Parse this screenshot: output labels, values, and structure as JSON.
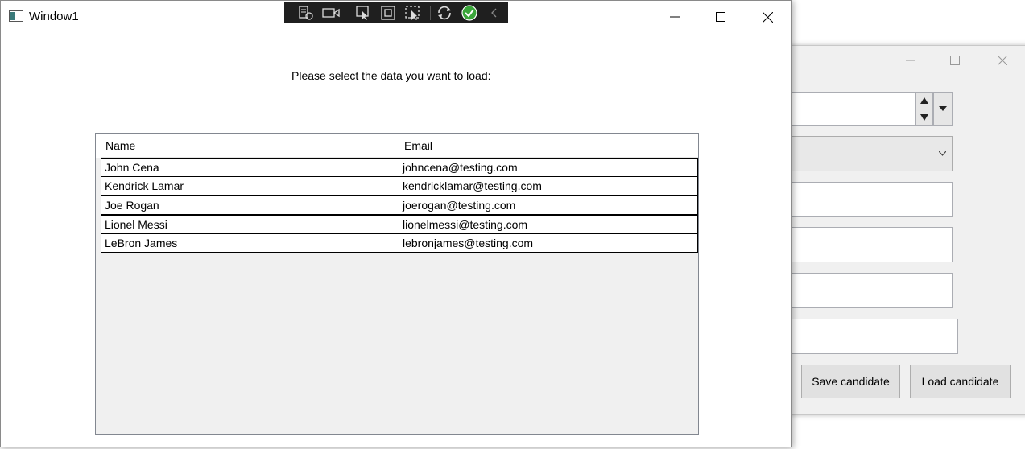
{
  "main_window": {
    "title": "Window1",
    "prompt": "Please select the data you want to load:",
    "columns": [
      "Name",
      "Email"
    ],
    "rows": [
      {
        "name": "John Cena",
        "email": "johncena@testing.com"
      },
      {
        "name": "Kendrick Lamar",
        "email": "kendricklamar@testing.com"
      },
      {
        "name": "Joe Rogan",
        "email": "joerogan@testing.com"
      },
      {
        "name": "Lionel Messi",
        "email": "lionelmessi@testing.com"
      },
      {
        "name": "LeBron James",
        "email": "lebronjames@testing.com"
      }
    ]
  },
  "background_window": {
    "save_button": "Save candidate",
    "load_button": "Load candidate"
  },
  "debug_toolbar": {
    "icons": [
      "visual-tree-icon",
      "record-icon",
      "select-element-icon",
      "display-layout-adorners-icon",
      "track-focus-icon",
      "hot-reload-icon",
      "binding-ok-icon",
      "collapse-icon"
    ],
    "accent_color": "#3aa53a"
  },
  "colors": {
    "grid_background": "#f0f0f0",
    "window_border": "#8a8a8a"
  }
}
